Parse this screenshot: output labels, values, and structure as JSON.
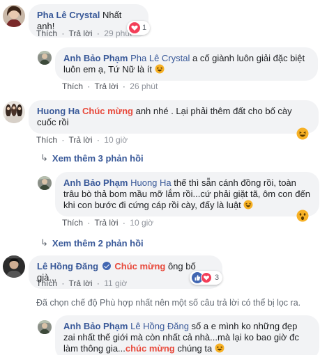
{
  "actions": {
    "like": "Thích",
    "reply": "Trả lời",
    "dot": "·"
  },
  "comments": [
    {
      "author": "Pha Lê Crystal",
      "text": "Nhất anh!",
      "time": "29 phút",
      "reaction_count": "1",
      "replies": [
        {
          "author": "Anh Bảo Phạm",
          "mention": "Pha Lê Crystal",
          "text": " a cố giành luôn giải đặc biệt luôn em ạ, Tứ Nữ là ít",
          "time": "26 phút"
        }
      ]
    },
    {
      "author": "Huong Ha",
      "highlight": "Chúc mừng",
      "text": " anh nhé . Lại phải thêm đất cho bố cày cuốc rồi",
      "time": "10 giờ",
      "more_replies": "Xem thêm 3 phản hồi",
      "replies": [
        {
          "author": "Anh Bảo Phạm",
          "mention": "Huong Ha",
          "text": " thế thì sẵn cánh đồng rồi, toàn trâu bò thả bom mầu mỡ lắm rồi...cứ phải giặt tã, ôm con đến khi con bước đi cứng cáp rồi cày, đấy là luật",
          "time": "10 giờ"
        }
      ],
      "more_replies_after": "Xem thêm 2 phản hồi"
    },
    {
      "author": "Lê Hồng Đăng",
      "highlight": "Chúc mừng",
      "text": " ông bố già...",
      "time": "11 giờ",
      "reaction_count": "3",
      "notice": "Đã chọn chế độ Phù hợp nhất nên một số câu trả lời có thể bị lọc ra.",
      "replies": [
        {
          "author": "Anh Bảo Phạm",
          "mention": "Lê Hồng Đăng",
          "text_before": " số a e mình ko những đẹp zai nhất thế giới mà còn nhất cả nhà...mà lại ko bao giờ đc làm thông gia...",
          "highlight": "chúc mừng",
          "text_after": " chúng ta"
        }
      ]
    }
  ],
  "colors": {
    "link": "#385898",
    "highlight": "#e84a3c",
    "bubble": "#f2f3f5",
    "like_blue": "#4267b2",
    "love_red": "#f33e58",
    "haha_yellow": "#f7b125"
  }
}
